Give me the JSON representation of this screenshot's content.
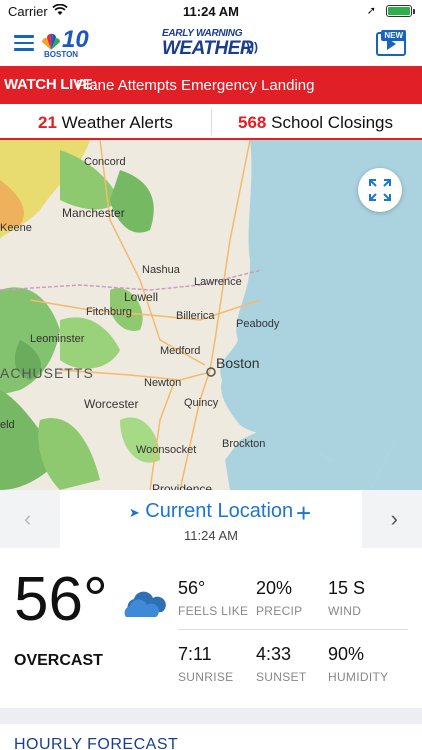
{
  "status_bar": {
    "carrier": "Carrier",
    "time": "11:24 AM"
  },
  "header": {
    "station_logo_number": "10",
    "station_logo_city": "BOSTON",
    "brand_top": "EARLY WARNING",
    "brand_bottom": "WEATHER",
    "video_badge": "NEW",
    "icons": [
      "menu-icon",
      "nbc-peacock-logo",
      "video-icon"
    ]
  },
  "banner": {
    "label": "WATCH LIVE:",
    "text": "Plane Attempts Emergency Landing",
    "color": "#e01f26"
  },
  "alerts": {
    "weather_count": "21",
    "weather_label": "Weather Alerts",
    "school_count": "568",
    "school_label": "School Closings"
  },
  "map": {
    "labels": {
      "concord": "Concord",
      "manchester": "Manchester",
      "keene": "Keene",
      "nashua": "Nashua",
      "lawrence": "Lawrence",
      "lowell": "Lowell",
      "fitchburg": "Fitchburg",
      "billerica": "Billerica",
      "peabody": "Peabody",
      "leominster": "Leominster",
      "medford": "Medford",
      "boston": "Boston",
      "massachusetts": "ACHUSETTS",
      "newton": "Newton",
      "worcester": "Worcester",
      "quincy": "Quincy",
      "field": "eld",
      "brockton": "Brockton",
      "woonsocket": "Woonsocket",
      "providence": "Providence"
    },
    "expand_icon": "expand-icon"
  },
  "location": {
    "name": "Current Location",
    "time": "11:24 AM",
    "prev_icon": "chevron-left-icon",
    "next_icon": "chevron-right-icon",
    "add_icon": "plus-icon"
  },
  "current": {
    "temperature": "56°",
    "condition": "OVERCAST",
    "condition_icon": "cloud-icon",
    "stats": [
      {
        "value": "56°",
        "label": "FEELS LIKE"
      },
      {
        "value": "20%",
        "label": "PRECIP"
      },
      {
        "value": "15 S",
        "label": "WIND"
      },
      {
        "value": "7:11",
        "label": "SUNRISE"
      },
      {
        "value": "4:33",
        "label": "SUNSET"
      },
      {
        "value": "90%",
        "label": "HUMIDITY"
      }
    ]
  },
  "hourly": {
    "title": "HOURLY FORECAST"
  }
}
